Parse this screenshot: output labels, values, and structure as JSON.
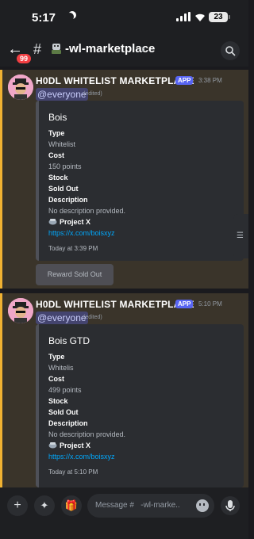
{
  "status_bar": {
    "time": "5:17",
    "battery": "23"
  },
  "header": {
    "unread_badge": "99",
    "hash": "#",
    "channel_name": "-wl-marketplace",
    "chevron": "›"
  },
  "messages": [
    {
      "author": "H0DL WHITELIST MARKETPLACE",
      "app_tag": "APP",
      "timestamp": "3:38 PM",
      "mention": "@everyone",
      "edited": "(edited)",
      "embed": {
        "title": "Bois",
        "type_label": "Type",
        "type_value": "Whitelist",
        "cost_label": "Cost",
        "cost_value": "150 points",
        "stock_label": "Stock",
        "stock_value": "Sold Out",
        "desc_label": "Description",
        "desc_value": "No description provided.",
        "project": "Project X",
        "link": "https://x.com/boisxyz",
        "footer": "Today at 3:39 PM"
      },
      "button": "Reward Sold Out"
    },
    {
      "author": "H0DL WHITELIST MARKETPLACE",
      "app_tag": "APP",
      "timestamp": "5:10 PM",
      "mention": "@everyone",
      "edited": "(edited)",
      "embed": {
        "title": "Bois GTD",
        "type_label": "Type",
        "type_value": "Whitelis",
        "cost_label": "Cost",
        "cost_value": "499 points",
        "stock_label": "Stock",
        "stock_value": "Sold Out",
        "desc_label": "Description",
        "desc_value": "No description provided.",
        "project": "Project X",
        "link": "https://x.com/boisxyz",
        "footer": "Today at 5:10 PM"
      }
    }
  ],
  "composer": {
    "placeholder": "Message #   -wl-marke.."
  },
  "colors": {
    "mention_bg": "#3a342a",
    "accent": "#f0b232",
    "app_tag": "#5865f2",
    "link": "#00a8fc",
    "badge": "#f23f43"
  },
  "icons": [
    "back-arrow-icon",
    "robot-emoji-icon",
    "search-icon",
    "moon-icon",
    "signal-icon",
    "wifi-icon",
    "battery-icon",
    "plus-icon",
    "apps-icon",
    "gift-icon",
    "emoji-icon",
    "microphone-icon",
    "thread-list-icon",
    "nft-emoji-icon"
  ]
}
